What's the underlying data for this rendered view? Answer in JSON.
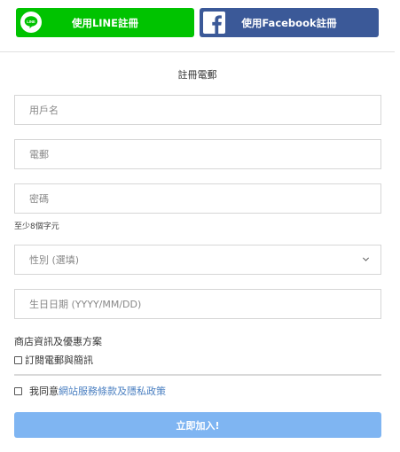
{
  "social": {
    "line_label": "使用LINE註冊",
    "line_icon": "line-logo-icon",
    "line_icon_text": "LINE",
    "facebook_label": "使用Facebook註冊",
    "facebook_icon": "facebook-logo-icon"
  },
  "form": {
    "title": "註冊電郵",
    "username_placeholder": "用戶名",
    "email_placeholder": "電郵",
    "password_placeholder": "密碼",
    "password_hint": "至少8個字元",
    "gender_placeholder": "性別 (選填)",
    "dob_placeholder": "生日日期 (YYYY/MM/DD)",
    "promo_title": "商店資訊及優惠方案",
    "subscribe_label": "訂閱電郵與簡訊",
    "subscribe_checked": false,
    "terms_prefix": "我同意",
    "terms_link": "網站服務條款及隱私政策",
    "terms_checked": false,
    "submit_label": "立即加入!"
  },
  "colors": {
    "line_green": "#00c300",
    "facebook_blue": "#3b5998",
    "submit_blue": "#7fb5f2",
    "link_blue": "#4a7fc1"
  }
}
